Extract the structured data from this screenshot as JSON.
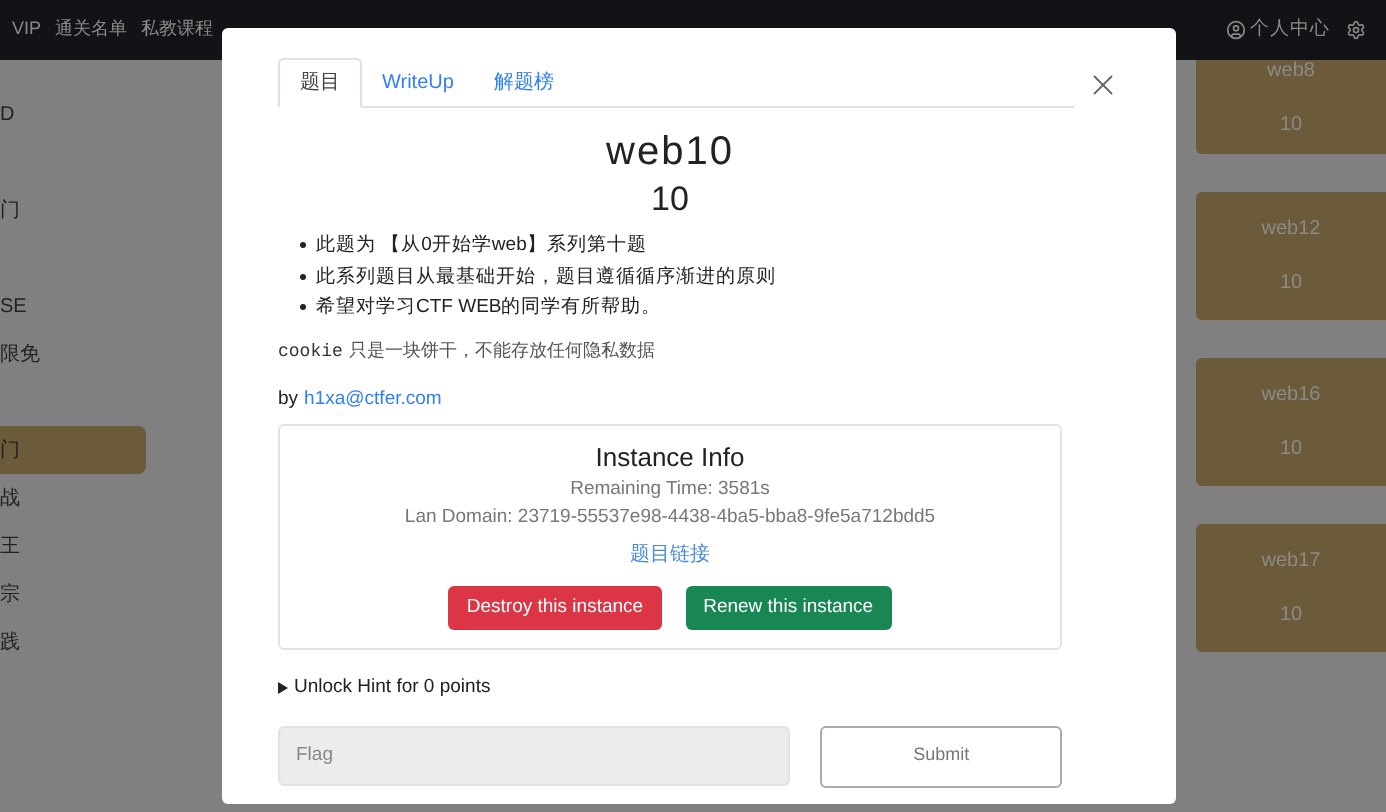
{
  "navbar": {
    "items": [
      "VIP",
      "通关名单",
      "私教课程"
    ],
    "user_menu": "个人中心"
  },
  "sidebar": {
    "groups": [
      [
        {
          "label": "D",
          "selected": false
        }
      ],
      [
        {
          "label": "门",
          "selected": false
        }
      ],
      [
        {
          "label": "SE",
          "selected": false
        },
        {
          "label": "限免",
          "selected": false
        }
      ],
      [
        {
          "label": "门",
          "selected": true
        },
        {
          "label": "战",
          "selected": false
        },
        {
          "label": "王",
          "selected": false
        },
        {
          "label": "宗",
          "selected": false
        },
        {
          "label": "践",
          "selected": false
        }
      ]
    ]
  },
  "cards": [
    {
      "name": "web8",
      "score": "10"
    },
    {
      "name": "web12",
      "score": "10"
    },
    {
      "name": "web16",
      "score": "10"
    },
    {
      "name": "web17",
      "score": "10"
    }
  ],
  "modal": {
    "tabs": [
      {
        "label": "题目",
        "selected": true
      },
      {
        "label": "WriteUp",
        "selected": false
      },
      {
        "label": "解题榜",
        "selected": false
      }
    ],
    "title": "web10",
    "score": "10",
    "bullets": [
      "此题为 【从0开始学web】系列第十题",
      "此系列题目从最基础开始，题目遵循循序渐进的原则",
      "希望对学习CTF WEB的同学有所帮助。"
    ],
    "note_code": "cookie",
    "note_text": "只是一块饼干，不能存放任何隐私数据",
    "author_prefix": "by",
    "author": "h1xa@ctfer.com",
    "instance": {
      "title": "Instance Info",
      "remaining": "Remaining Time: 3581s",
      "domain": "Lan Domain: 23719-55537e98-4438-4ba5-bba8-9fe5a712bdd5",
      "link": "题目链接",
      "buttons": [
        {
          "label": "Destroy this instance",
          "kind": "danger"
        },
        {
          "label": "Renew this instance",
          "kind": "success"
        }
      ]
    },
    "hint": "Unlock Hint for 0 points",
    "flag": {
      "placeholder": "Flag"
    },
    "submit": "Submit"
  }
}
